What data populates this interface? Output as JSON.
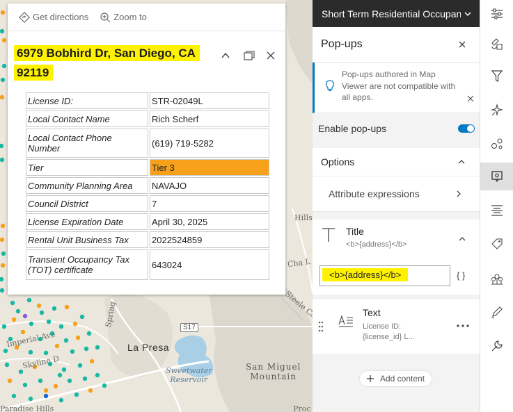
{
  "popup": {
    "actions": {
      "directions": "Get directions",
      "zoom": "Zoom to"
    },
    "title_line1": "6979 Bobhird Dr, San Diego, CA",
    "title_line2": "92119",
    "attributes": [
      {
        "key": "License ID:",
        "value": "STR-02049L"
      },
      {
        "key": "Local Contact Name",
        "value": "Rich Scherf"
      },
      {
        "key": "Local Contact Phone Number",
        "value": "(619) 719-5282"
      },
      {
        "key": "Tier",
        "value": "Tier 3"
      },
      {
        "key": "Community Planning Area",
        "value": "NAVAJO"
      },
      {
        "key": "Council District",
        "value": "7"
      },
      {
        "key": "License Expiration Date",
        "value": "April 30, 2025"
      },
      {
        "key": "Rental Unit Business Tax",
        "value": "2022524859"
      },
      {
        "key": "Transient Occupancy Tax (TOT) certificate",
        "value": "643024"
      }
    ],
    "tier_color": "#f7a11a",
    "highlight_color": "#fff200"
  },
  "map": {
    "labels": {
      "la_presa": "La Presa",
      "sweetwater": "Sweetwater\nReservoir",
      "san_miguel": "San Miguel\nMountain",
      "imperial": "Imperial Ave",
      "skyline": "Skyline D",
      "spring": "Spring",
      "hillsd": "Hillsd",
      "cha": "Cha L",
      "steele": "Steele Ca",
      "paradise": "Paradise Hills",
      "proc": "Proc"
    },
    "highway": "S17",
    "dot_colors": {
      "teal": "#16b9a3",
      "orange": "#f7a11a",
      "purple": "#8a5bd6",
      "blue": "#1f66c9"
    }
  },
  "panel": {
    "layer_title": "Short Term Residential Occupancy",
    "section_title": "Pop-ups",
    "notice": "Pop-ups authored in Map Viewer are not compatible with all apps.",
    "enable_label": "Enable pop-ups",
    "enabled": true,
    "options_label": "Options",
    "attribute_expressions": "Attribute expressions",
    "title_block": {
      "label": "Title",
      "preview": "<b>{address}</b>",
      "input_value": "<b>{address}</b>",
      "braces": "{ }"
    },
    "text_block": {
      "label": "Text",
      "preview": "License ID: {license_id} L..."
    },
    "add_content": "Add content",
    "accent": "#007ac2"
  },
  "toolbar": {
    "tools": [
      "properties-icon",
      "styles-icon",
      "filter-icon",
      "effects-icon",
      "clustering-icon",
      "popups-icon",
      "fields-icon",
      "labels-icon",
      "charts-icon",
      "sketch-icon",
      "configure-icon"
    ],
    "active": "popups-icon"
  }
}
